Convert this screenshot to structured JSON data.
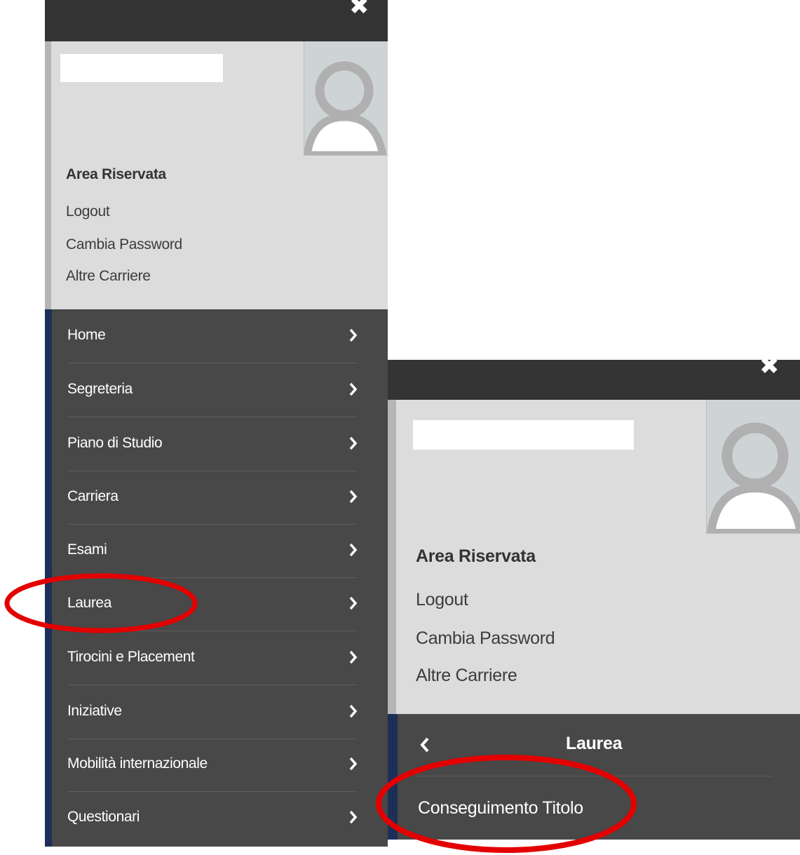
{
  "header": {
    "section_title": "Area Riservata",
    "links": [
      "Logout",
      "Cambia Password",
      "Altre Carriere"
    ]
  },
  "menu": {
    "items": [
      "Home",
      "Segreteria",
      "Piano di Studio",
      "Carriera",
      "Esami",
      "Laurea",
      "Tirocini e Placement",
      "Iniziative",
      "Mobilità internazionale",
      "Questionari"
    ]
  },
  "submenu": {
    "title": "Laurea",
    "items": [
      "Conseguimento Titolo"
    ]
  },
  "icons": {
    "close": "close-icon",
    "avatar": "user-avatar-icon",
    "chevron_right": "chevron-right-icon",
    "back": "chevron-left-icon"
  },
  "colors": {
    "topbar": "#343434",
    "header_bg": "#dcdcdc",
    "menu_bg": "#484848",
    "menu_accent": "#1c2f57",
    "annotation": "#e30000"
  }
}
